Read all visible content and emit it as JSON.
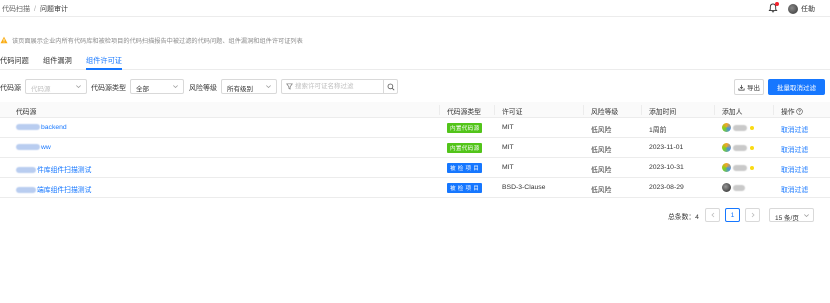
{
  "breadcrumb": {
    "parent": "代码扫描",
    "current": "问题审计"
  },
  "header": {
    "user_name": "任勒"
  },
  "warning": {
    "text": "该页面展示企业内所有代码库和被检项目的代码扫描报告中被过滤的代码问题、组件漏洞和组件许可证列表"
  },
  "tabs": [
    {
      "label": "代码问题",
      "active": false
    },
    {
      "label": "组件漏洞",
      "active": false
    },
    {
      "label": "组件许可证",
      "active": true
    }
  ],
  "filters": {
    "source_label": "代码源",
    "source_placeholder": "代码源",
    "source_type_label": "代码源类型",
    "source_type_value": "全部",
    "risk_label": "风险等级",
    "risk_value": "所有级别",
    "search_placeholder": "搜索许可证名称过滤"
  },
  "toolbar": {
    "export_label": "导出",
    "batch_label": "批量取消过滤"
  },
  "table": {
    "columns": [
      "代码源",
      "代码源类型",
      "许可证",
      "风险等级",
      "添加时间",
      "添加人",
      "操作"
    ],
    "rows": [
      {
        "source": "backend",
        "source_type": "内置代码源",
        "type_color": "green",
        "license": "MIT",
        "risk": "低风险",
        "time": "1周前",
        "action": "取消过滤"
      },
      {
        "source": "ww",
        "source_type": "内置代码源",
        "type_color": "green",
        "license": "MIT",
        "risk": "低风险",
        "time": "2023-11-01",
        "action": "取消过滤"
      },
      {
        "source": "件库组件扫描测试",
        "source_type": "被 检 项 目",
        "type_color": "blue",
        "license": "MIT",
        "risk": "低风险",
        "time": "2023-10-31",
        "action": "取消过滤"
      },
      {
        "source": "端库组件扫描测试",
        "source_type": "被 检 项 目",
        "type_color": "blue",
        "license": "BSD-3-Clause",
        "risk": "低风险",
        "time": "2023-08-29",
        "action": "取消过滤"
      }
    ]
  },
  "pagination": {
    "total_label": "总条数：4",
    "current_page": "1",
    "page_size": "15 条/页"
  },
  "colors": {
    "accent": "#1677ff",
    "tag_green": "#52c41a",
    "warn": "#faad14"
  }
}
